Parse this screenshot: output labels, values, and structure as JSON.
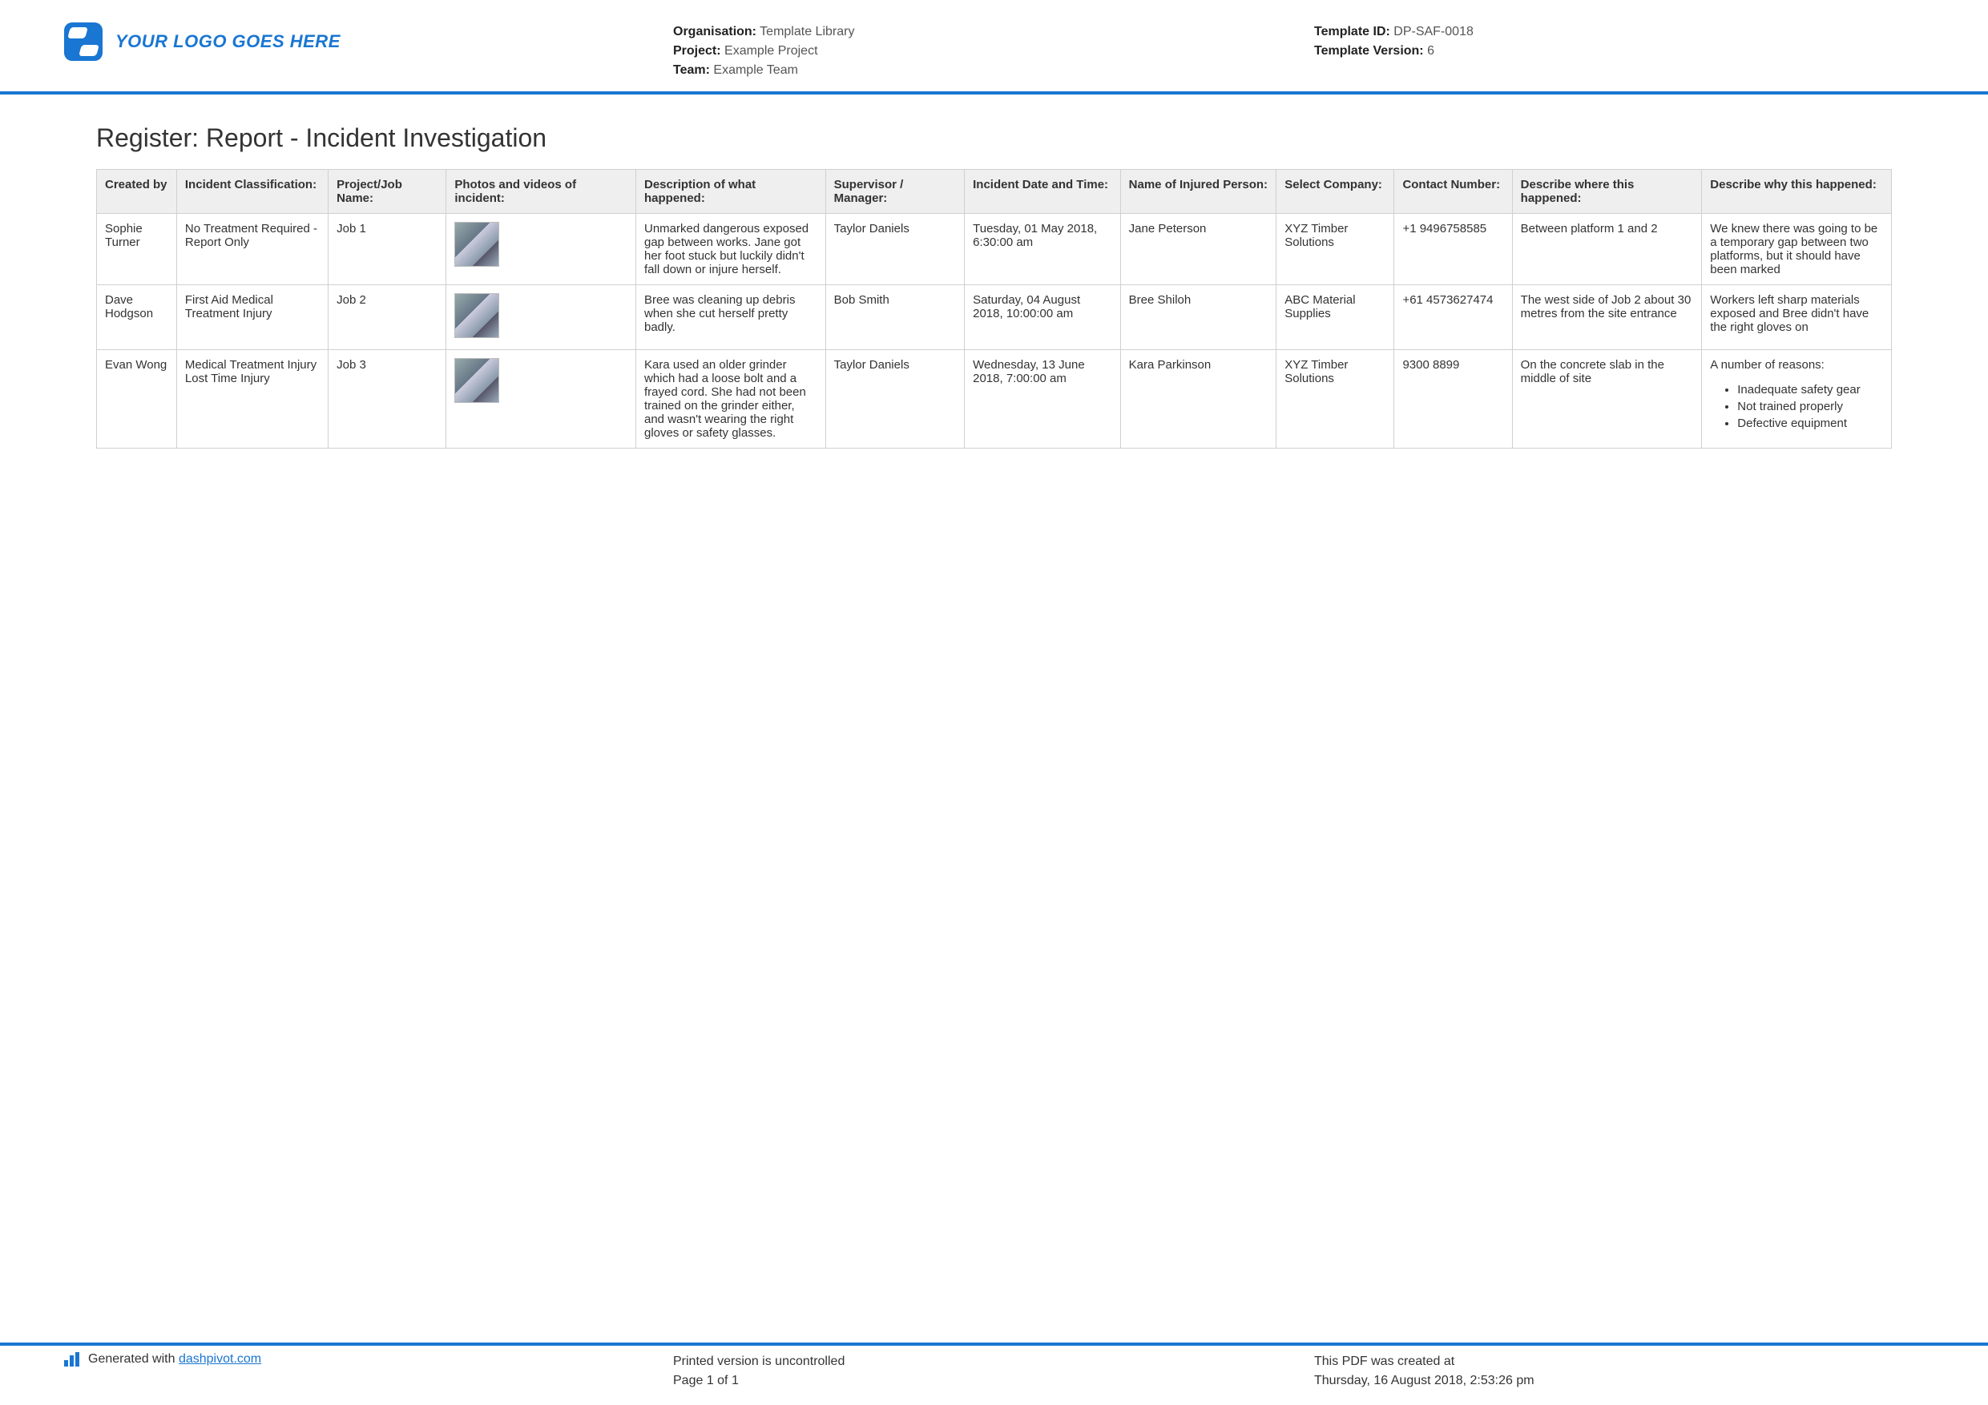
{
  "header": {
    "logo_text": "YOUR LOGO GOES HERE",
    "center": {
      "organisation": {
        "label": "Organisation:",
        "value": "Template Library"
      },
      "project": {
        "label": "Project:",
        "value": "Example Project"
      },
      "team": {
        "label": "Team:",
        "value": "Example Team"
      }
    },
    "right": {
      "template_id": {
        "label": "Template ID:",
        "value": "DP-SAF-0018"
      },
      "template_version": {
        "label": "Template Version:",
        "value": "6"
      }
    }
  },
  "title": "Register: Report - Incident Investigation",
  "table": {
    "headers": [
      "Created by",
      "Incident Classification:",
      "Project/Job Name:",
      "Photos and videos of incident:",
      "Description of what happened:",
      "Supervisor / Manager:",
      "Incident Date and Time:",
      "Name of Injured Person:",
      "Select Company:",
      "Contact Number:",
      "Describe where this happened:",
      "Describe why this happened:"
    ],
    "rows": [
      {
        "created_by": "Sophie Turner",
        "classification": "No Treatment Required - Report Only",
        "job": "Job 1",
        "photo_name": "incident-photo-1",
        "description": "Unmarked dangerous exposed gap between works. Jane got her foot stuck but luckily didn't fall down or injure herself.",
        "supervisor": "Taylor Daniels",
        "datetime": "Tuesday, 01 May 2018, 6:30:00 am",
        "injured": "Jane Peterson",
        "company": "XYZ Timber Solutions",
        "contact": "+1 9496758585",
        "where": "Between platform 1 and 2",
        "why": "We knew there was going to be a temporary gap between two platforms, but it should have been marked",
        "why_list": []
      },
      {
        "created_by": "Dave Hodgson",
        "classification": "First Aid   Medical Treatment Injury",
        "job": "Job 2",
        "photo_name": "incident-photo-2",
        "description": "Bree was cleaning up debris when she cut herself pretty badly.",
        "supervisor": "Bob Smith",
        "datetime": "Saturday, 04 August 2018, 10:00:00 am",
        "injured": "Bree Shiloh",
        "company": "ABC Material Supplies",
        "contact": "+61 4573627474",
        "where": "The west side of Job 2 about 30 metres from the site entrance",
        "why": "Workers left sharp materials exposed and Bree didn't have the right gloves on",
        "why_list": []
      },
      {
        "created_by": "Evan Wong",
        "classification": "Medical Treatment Injury   Lost Time Injury",
        "job": "Job 3",
        "photo_name": "incident-photo-3",
        "description": "Kara used an older grinder which had a loose bolt and a frayed cord. She had not been trained on the grinder either, and wasn't wearing the right gloves or safety glasses.",
        "supervisor": "Taylor Daniels",
        "datetime": "Wednesday, 13 June 2018, 7:00:00 am",
        "injured": "Kara Parkinson",
        "company": "XYZ Timber Solutions",
        "contact": "9300 8899",
        "where": "On the concrete slab in the middle of site",
        "why": "A number of reasons:",
        "why_list": [
          "Inadequate safety gear",
          "Not trained properly",
          "Defective equipment"
        ]
      }
    ]
  },
  "footer": {
    "generated_prefix": "Generated with ",
    "generated_link": "dashpivot.com",
    "center_line1": "Printed version is uncontrolled",
    "center_line2": "Page 1 of 1",
    "right_line1": "This PDF was created at",
    "right_line2": "Thursday, 16 August 2018, 2:53:26 pm"
  }
}
